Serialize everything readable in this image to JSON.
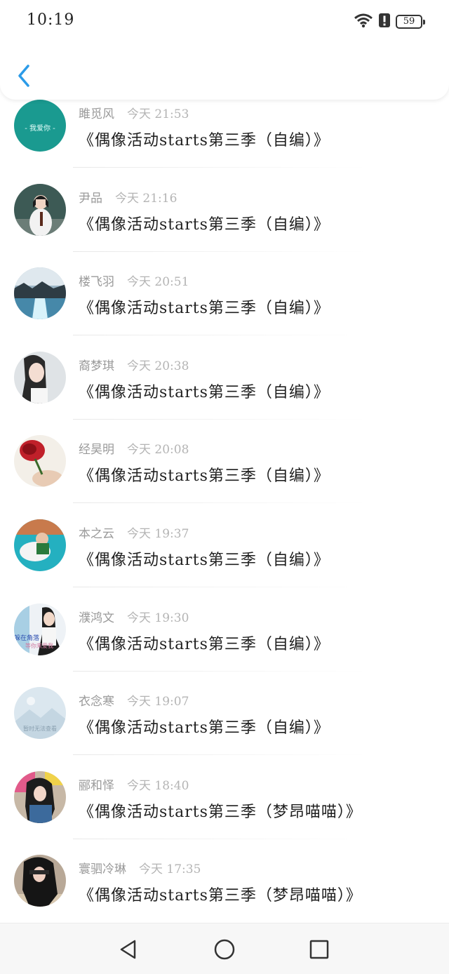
{
  "status_bar": {
    "time": "10:19",
    "battery": "59",
    "icons": [
      "wifi-icon",
      "alert-icon",
      "battery-icon"
    ]
  },
  "header": {
    "back_icon": "chevron-left-icon",
    "accent_color": "#2b9be8"
  },
  "messages": [
    {
      "name": "雎觅风",
      "time": "今天 21:53",
      "text": "《偶像活动starts第三季（自编）》",
      "avatar_label": "- 我爱你 -"
    },
    {
      "name": "尹品",
      "time": "今天 21:16",
      "text": "《偶像活动starts第三季（自编）》"
    },
    {
      "name": "楼飞羽",
      "time": "今天 20:51",
      "text": "《偶像活动starts第三季（自编）》"
    },
    {
      "name": "裔梦琪",
      "time": "今天 20:38",
      "text": "《偶像活动starts第三季（自编）》"
    },
    {
      "name": "经昊明",
      "time": "今天 20:08",
      "text": "《偶像活动starts第三季（自编）》"
    },
    {
      "name": "本之云",
      "time": "今天 19:37",
      "text": "《偶像活动starts第三季（自编）》"
    },
    {
      "name": "濮鸿文",
      "time": "今天 19:30",
      "text": "《偶像活动starts第三季（自编）》",
      "avatar_label": "躲在角落",
      "avatar_label2": "等你来爱我"
    },
    {
      "name": "衣念寒",
      "time": "今天 19:07",
      "text": "《偶像活动starts第三季（自编）》",
      "avatar_label": "暂时无法查看"
    },
    {
      "name": "郦和怿",
      "time": "今天 18:40",
      "text": "《偶像活动starts第三季（梦昂喵喵）》"
    },
    {
      "name": "寰驷冷琳",
      "time": "今天 17:35",
      "text": "《偶像活动starts第三季（梦昂喵喵）》"
    }
  ],
  "nav_bar": {
    "back_icon": "triangle-back-icon",
    "home_icon": "circle-home-icon",
    "recent_icon": "square-recents-icon"
  }
}
